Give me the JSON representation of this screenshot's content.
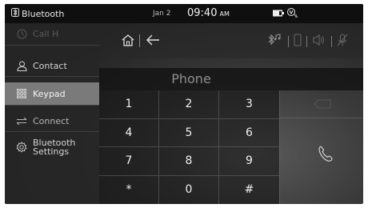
{
  "status_bar": {
    "app_title": "Bluetooth",
    "date": "Jan 2",
    "time": "09:40",
    "ampm": "AM"
  },
  "sidebar": {
    "items": [
      {
        "label": "Call H",
        "icon": "history-icon",
        "state": "disabled"
      },
      {
        "label": "Contact",
        "icon": "contact-icon",
        "state": "normal"
      },
      {
        "label": "Keypad",
        "icon": "keypad-icon",
        "state": "active"
      },
      {
        "label": "Connect",
        "icon": "connect-icon",
        "state": "normal"
      },
      {
        "label": "Bluetooth",
        "label2": "Settings",
        "icon": "gear-icon",
        "state": "normal"
      }
    ]
  },
  "phone": {
    "title": "Phone",
    "keys": [
      "1",
      "2",
      "3",
      "4",
      "5",
      "6",
      "7",
      "8",
      "9",
      "*",
      "0",
      "#"
    ]
  },
  "colors": {
    "active_item_bg": "#7a7a7a",
    "status_bar_bg": "#0f0f0f",
    "text": "#e6e6e6"
  }
}
